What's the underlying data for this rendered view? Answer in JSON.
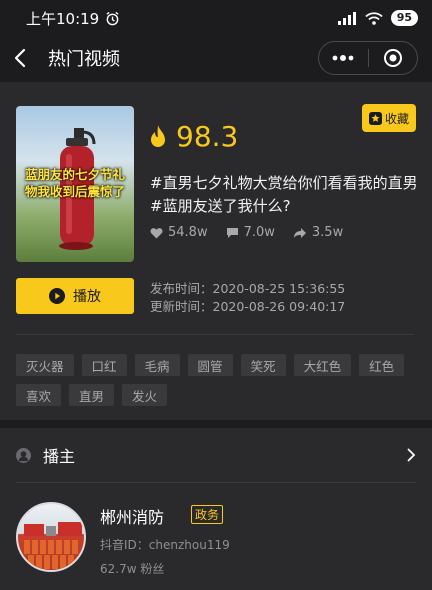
{
  "status_bar": {
    "time": "上午10:19",
    "battery": "95",
    "network": "4G"
  },
  "nav": {
    "title": "热门视频"
  },
  "video": {
    "thumbnail_caption": "蓝朋友的七夕节礼物我收到后震惊了",
    "score": "98.3",
    "collect_label": "收藏",
    "title": "#直男七夕礼物大赏给你们看看我的直男#蓝朋友送了我什么?",
    "likes": "54.8w",
    "comments": "7.0w",
    "shares": "3.5w",
    "play_label": "播放",
    "publish_time": "发布时间：2020-08-25 15:36:55",
    "update_time": "更新时间：2020-08-26 09:40:17",
    "tags": [
      "灭火器",
      "口红",
      "毛病",
      "圆管",
      "笑死",
      "大红色",
      "红色",
      "喜欢",
      "直男",
      "发火"
    ]
  },
  "host": {
    "section_label": "播主",
    "name": "郴州消防",
    "badge": "政务",
    "douyin_id": "抖音ID：chenzhou119",
    "fans": "62.7w 粉丝"
  },
  "colors": {
    "accent": "#f8c81c",
    "background": "#1c1c1e",
    "card": "#2a2a2d",
    "muted_text": "#a8a8ac"
  }
}
